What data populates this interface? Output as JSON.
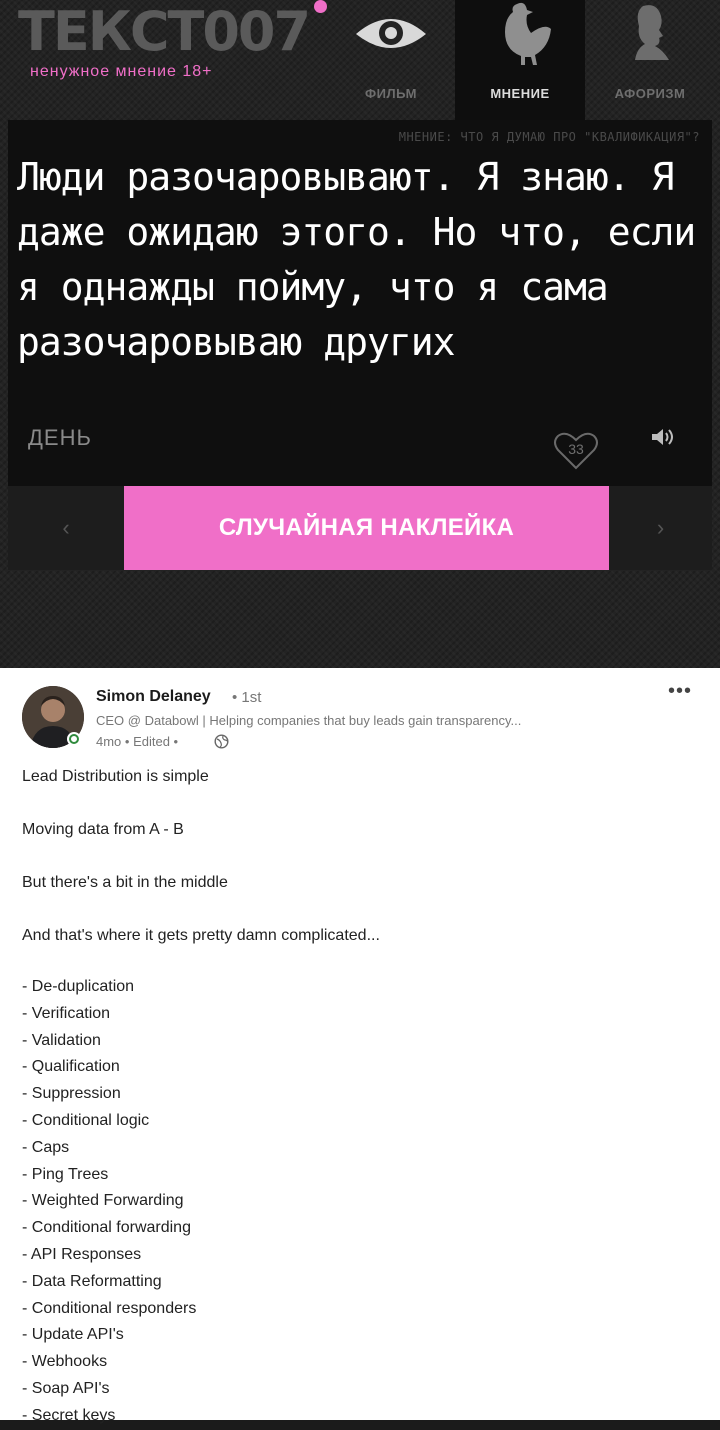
{
  "site": {
    "logo": "ТЕКСТ007",
    "tagline": "ненужное мнение 18+",
    "colors": {
      "accent": "#f06fc8",
      "background": "#232323",
      "panel": "#0f0f0f"
    }
  },
  "nav": [
    {
      "label": "ФИЛЬМ",
      "icon": "eye-icon",
      "active": false
    },
    {
      "label": "МНЕНИЕ",
      "icon": "chicken-icon",
      "active": true
    },
    {
      "label": "АФОРИЗМ",
      "icon": "bust-icon",
      "active": false
    }
  ],
  "quote": {
    "reference": "МНЕНИЕ: ЧТО Я ДУМАЮ ПРО \"КВАЛИФИКАЦИЯ\"?",
    "text": "Люди разочаровывают. Я знаю. Я даже ожидаю этого. Но что, если я однажды пойму, что я сама разочаровываю других",
    "category": "ДЕНЬ",
    "likes": "33"
  },
  "sticker_bar": {
    "prev": "‹",
    "button": "СЛУЧАЙНАЯ НАКЛЕЙКА",
    "next": "›"
  },
  "post": {
    "author": "Simon Delaney",
    "degree": "• 1st",
    "headline": "CEO @ Databowl | Helping companies that buy leads gain transparency...",
    "meta": "4mo • Edited •",
    "more": "•••",
    "lines": [
      "Lead Distribution is simple",
      "Moving data from A - B",
      "But there's a bit in the middle",
      "And that's where it gets pretty damn complicated..."
    ],
    "bullets": [
      "- De-duplication",
      "- Verification",
      "- Validation",
      "- Qualification",
      "- Suppression",
      "- Conditional logic",
      "- Caps",
      "- Ping Trees",
      "- Weighted Forwarding",
      "- Conditional forwarding",
      "- API Responses",
      "- Data Reformatting",
      "- Conditional responders",
      "- Update API's",
      "- Webhooks",
      "- Soap API's",
      "- Secret keys"
    ]
  }
}
